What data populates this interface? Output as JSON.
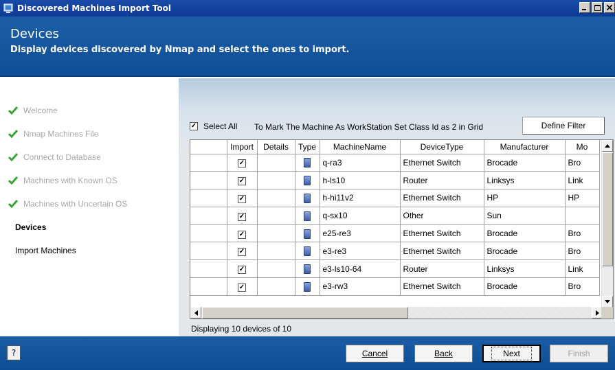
{
  "window": {
    "title": "Discovered Machines Import Tool"
  },
  "header": {
    "title": "Devices",
    "subtitle": "Display devices discovered by Nmap and select the ones to import."
  },
  "steps": [
    {
      "label": "Welcome",
      "state": "done"
    },
    {
      "label": "Nmap Machines File",
      "state": "done"
    },
    {
      "label": "Connect to Database",
      "state": "done"
    },
    {
      "label": "Machines with Known OS",
      "state": "done"
    },
    {
      "label": "Machines with Uncertain OS",
      "state": "done"
    },
    {
      "label": "Devices",
      "state": "active"
    },
    {
      "label": "Import Machines",
      "state": "pending"
    }
  ],
  "toolbar": {
    "select_all_label": "Select All",
    "select_all_checked": true,
    "hint": "To Mark The Machine As WorkStation Set Class Id as 2 in Grid",
    "define_filter_label": "Define Filter"
  },
  "grid": {
    "columns": [
      "",
      "Import",
      "Details",
      "Type",
      "MachineName",
      "DeviceType",
      "Manufacturer",
      "Mo"
    ],
    "rows": [
      {
        "import": true,
        "name": "q-ra3",
        "device_type": "Ethernet Switch",
        "manufacturer": "Brocade",
        "model": "Bro"
      },
      {
        "import": true,
        "name": "h-ls10",
        "device_type": "Router",
        "manufacturer": "Linksys",
        "model": "Link"
      },
      {
        "import": true,
        "name": "h-hi11v2",
        "device_type": "Ethernet Switch",
        "manufacturer": "HP",
        "model": "HP"
      },
      {
        "import": true,
        "name": "q-sx10",
        "device_type": "Other",
        "manufacturer": "Sun",
        "model": ""
      },
      {
        "import": true,
        "name": "e25-re3",
        "device_type": "Ethernet Switch",
        "manufacturer": "Brocade",
        "model": "Bro"
      },
      {
        "import": true,
        "name": "e3-re3",
        "device_type": "Ethernet Switch",
        "manufacturer": "Brocade",
        "model": "Bro"
      },
      {
        "import": true,
        "name": "e3-ls10-64",
        "device_type": "Router",
        "manufacturer": "Linksys",
        "model": "Link"
      },
      {
        "import": true,
        "name": "e3-rw3",
        "device_type": "Ethernet Switch",
        "manufacturer": "Brocade",
        "model": "Bro"
      }
    ]
  },
  "status": "Displaying 10 devices of 10",
  "footer": {
    "help": "?",
    "cancel": "Cancel",
    "back": "Back",
    "next": "Next",
    "finish": "Finish"
  }
}
